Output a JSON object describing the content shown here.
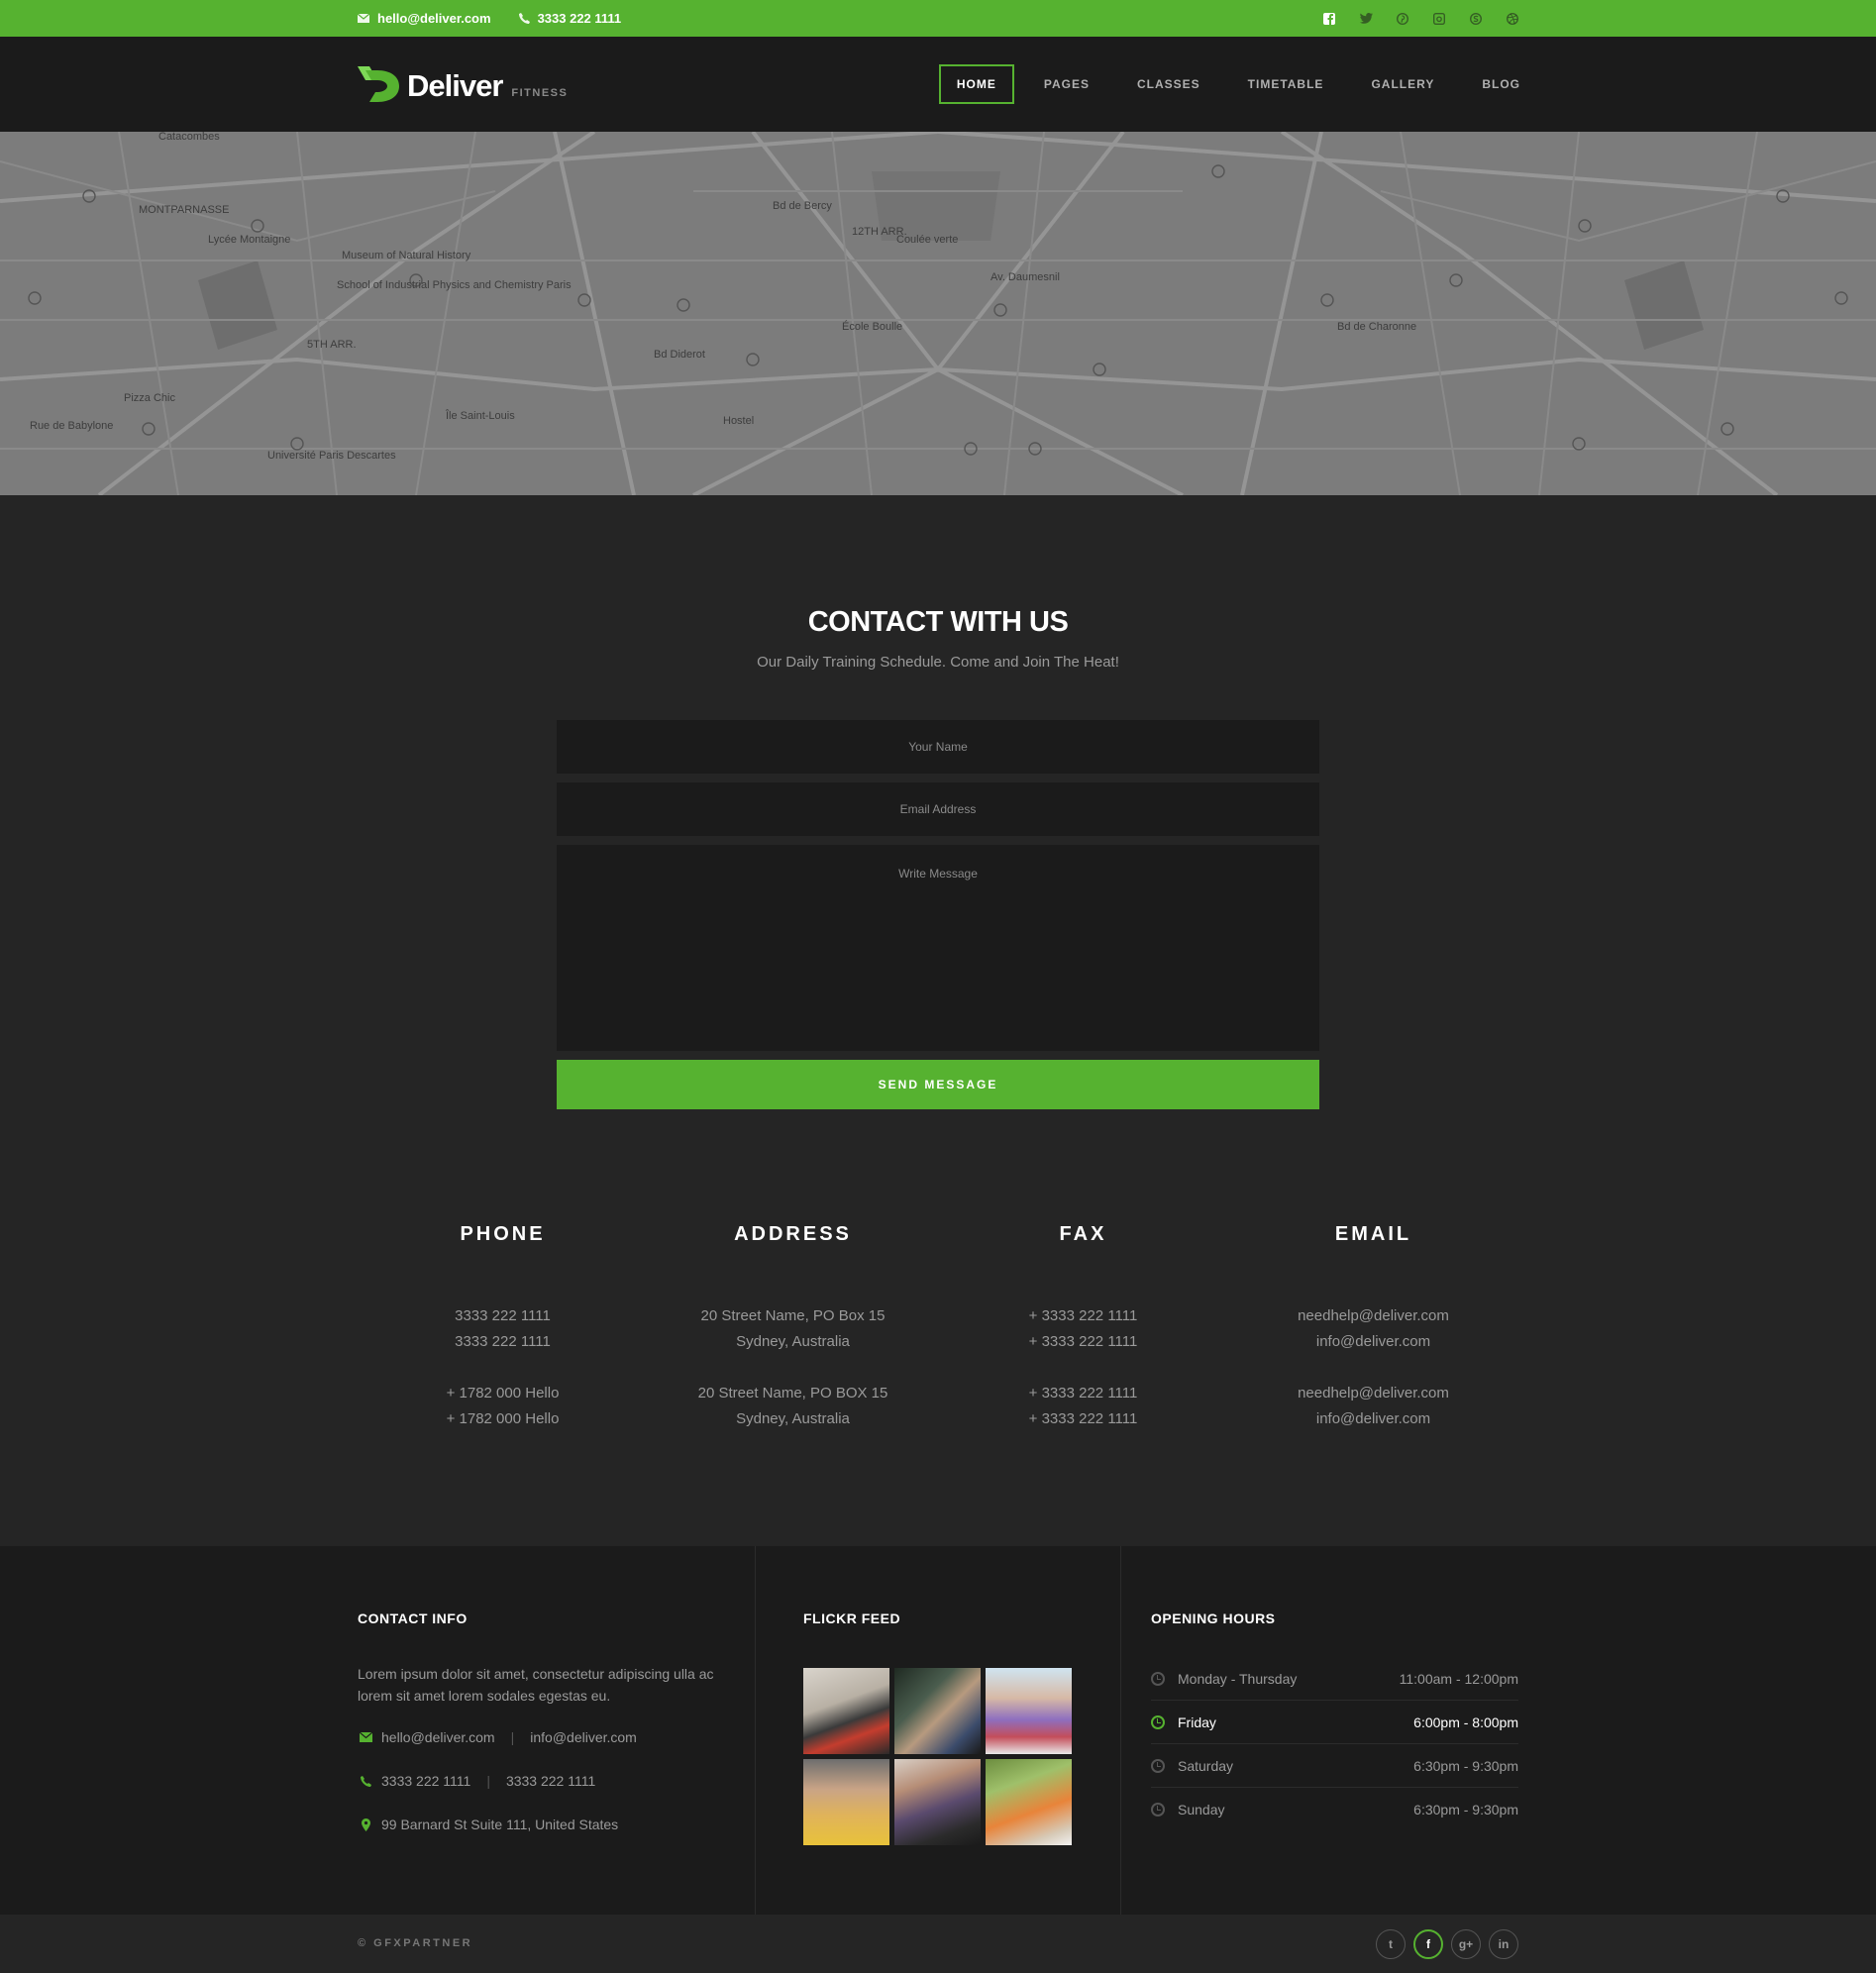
{
  "topbar": {
    "email": "hello@deliver.com",
    "phone": "3333 222 1111",
    "social_icons": [
      "facebook-icon",
      "twitter-icon",
      "pinterest-icon",
      "instagram-icon",
      "skype-icon",
      "dribbble-icon"
    ]
  },
  "header": {
    "logo_name": "Deliver",
    "logo_sub": "FITNESS",
    "nav": [
      "HOME",
      "PAGES",
      "CLASSES",
      "TIMETABLE",
      "GALLERY",
      "BLOG"
    ],
    "active_nav": "HOME"
  },
  "map": {
    "labels": [
      "Catacombes",
      "MONTPARNASSE",
      "Lycée Montaigne",
      "Museum of Natural History",
      "School of Industrial Physics and Chemistry Paris",
      "5TH ARR.",
      "Pizza Chic",
      "Rue de Babylone",
      "Université Paris Descartes",
      "Île Saint-Louis",
      "Bd Diderot",
      "Bd de Bercy",
      "12TH ARR.",
      "Coulée verte",
      "École Boulle",
      "Hostel",
      "Bd de Charonne",
      "Av. Daumesnil"
    ]
  },
  "contact": {
    "title": "CONTACT WITH US",
    "subtitle": "Our Daily Training Schedule. Come and Join The Heat!",
    "name_placeholder": "Your Name",
    "email_placeholder": "Email Address",
    "message_placeholder": "Write Message",
    "send_label": "SEND MESSAGE"
  },
  "info": [
    {
      "title": "PHONE",
      "lines": [
        "3333 222 1111",
        "3333 222 1111",
        "",
        "+ 1782 000 Hello",
        "+ 1782 000 Hello"
      ]
    },
    {
      "title": "ADDRESS",
      "lines": [
        "20 Street Name, PO Box 15",
        "Sydney, Australia",
        "",
        "20 Street Name, PO BOX 15",
        "Sydney, Australia"
      ]
    },
    {
      "title": "FAX",
      "lines": [
        "+ 3333 222 1111",
        "+ 3333 222 1111",
        "",
        "+ 3333 222 1111",
        "+ 3333 222 1111"
      ]
    },
    {
      "title": "EMAIL",
      "lines": [
        "needhelp@deliver.com",
        "info@deliver.com",
        "",
        "needhelp@deliver.com",
        "info@deliver.com"
      ]
    }
  ],
  "footer": {
    "contact_title": "CONTACT INFO",
    "contact_desc": "Lorem ipsum dolor sit amet, consectetur adipiscing ulla ac lorem sit amet lorem sodales egestas eu.",
    "email_1": "hello@deliver.com",
    "email_2": "info@deliver.com",
    "phone_1": "3333 222 1111",
    "phone_2": "3333 222 1111",
    "address": "99 Barnard St Suite 111,  United States",
    "flickr_title": "FLICKR FEED",
    "hours_title": "OPENING HOURS",
    "hours": [
      {
        "day": "Monday  - Thursday",
        "time": "11:00am - 12:00pm"
      },
      {
        "day": "Friday",
        "time": "6:00pm - 8:00pm"
      },
      {
        "day": "Saturday",
        "time": "6:30pm - 9:30pm"
      },
      {
        "day": "Sunday",
        "time": "6:30pm - 9:30pm"
      }
    ],
    "highlighted_day": "Friday"
  },
  "bottombar": {
    "copyright": "© GFXPARTNER",
    "social": [
      {
        "icon": "twitter-icon",
        "glyph": "t"
      },
      {
        "icon": "facebook-icon",
        "glyph": "f"
      },
      {
        "icon": "google-plus-icon",
        "glyph": "g+"
      },
      {
        "icon": "linkedin-icon",
        "glyph": "in"
      }
    ]
  },
  "colors": {
    "accent": "#56b230",
    "dark": "#1b1b1b",
    "panel": "#252525"
  }
}
